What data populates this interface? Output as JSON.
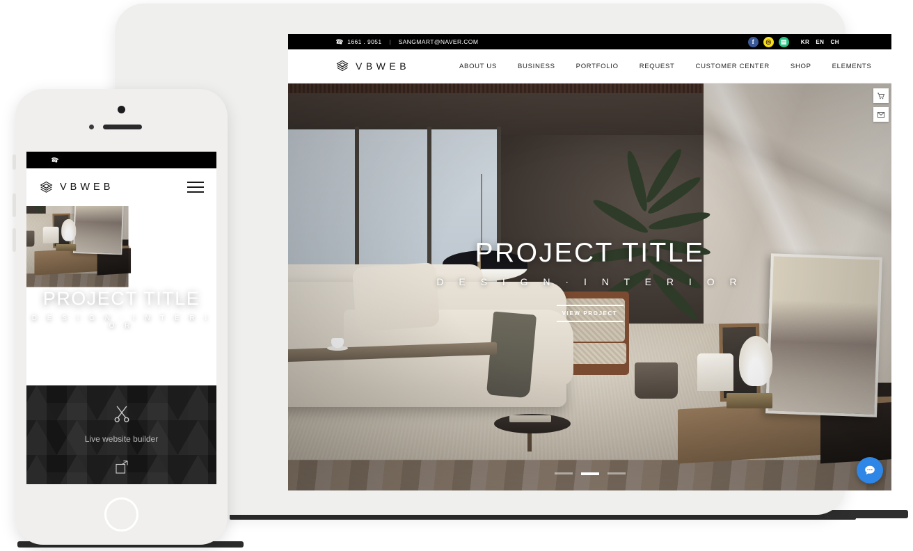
{
  "brand": {
    "name": "VBWEB",
    "logo_icon": "layered-hexagon-logo-icon"
  },
  "topbar": {
    "phone_icon": "phone-icon",
    "phone": "1661 . 9051",
    "separator": "|",
    "email": "SANGMART@NAVER.COM",
    "social": [
      {
        "name": "facebook",
        "glyph": "f",
        "color": "#3b5998"
      },
      {
        "name": "kakaotalk",
        "glyph": "◎",
        "color": "#f7e017"
      },
      {
        "name": "naver-talk",
        "glyph": "▤",
        "color": "#26c281"
      }
    ],
    "languages": [
      "KR",
      "EN",
      "CH"
    ]
  },
  "nav": {
    "items": [
      "ABOUT US",
      "BUSINESS",
      "PORTFOLIO",
      "REQUEST",
      "CUSTOMER CENTER",
      "SHOP",
      "ELEMENTS"
    ]
  },
  "hero": {
    "title": "PROJECT TITLE",
    "subtitle": "D E S I G N · I N T E R I O R",
    "button": "VIEW PROJECT",
    "slides_total": 3,
    "active_slide": 2
  },
  "side_buttons": [
    {
      "name": "cart-icon",
      "glyph": "🛒"
    },
    {
      "name": "mail-icon",
      "glyph": "✉"
    }
  ],
  "chat": {
    "icon": "chat-bubble-icon",
    "glyph": "●●●",
    "color": "#2e86e6"
  },
  "mobile": {
    "menu_icon": "hamburger-menu-icon",
    "builder": {
      "icon": "scissors-icon",
      "label": "Live website builder",
      "expand_icon": "expand-arrow-icon"
    }
  },
  "devices": {
    "tablet": {
      "name": "tablet-device",
      "home_button": "tablet-home-button"
    },
    "phone": {
      "name": "phone-device",
      "home_button": "phone-home-button"
    }
  }
}
